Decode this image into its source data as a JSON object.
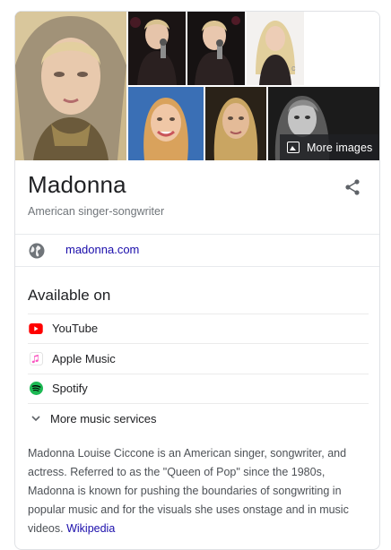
{
  "knowledge_panel": {
    "more_images_label": "More images",
    "name": "Madonna",
    "subtitle": "American singer-songwriter",
    "website": {
      "text": "madonna.com",
      "icon": "globe-icon"
    },
    "share_icon": "share-icon",
    "available_on": {
      "heading": "Available on",
      "services": [
        {
          "label": "YouTube",
          "icon": "youtube-icon",
          "color": "#ff0000"
        },
        {
          "label": "Apple Music",
          "icon": "apple-music-icon",
          "color": "#fa57c1"
        },
        {
          "label": "Spotify",
          "icon": "spotify-icon",
          "color": "#1db954"
        }
      ],
      "more_label": "More music services"
    },
    "description": {
      "text": "Madonna Louise Ciccone is an American singer, songwriter, and actress. Referred to as the \"Queen of Pop\" since the 1980s, Madonna is known for pushing the boundaries of songwriting in popular music and for the visuals she uses onstage and in music videos.",
      "source_label": "Wikipedia"
    },
    "colors": {
      "link": "#1a0dab",
      "secondary_text": "#70757a",
      "divider": "#e8eaed"
    }
  }
}
